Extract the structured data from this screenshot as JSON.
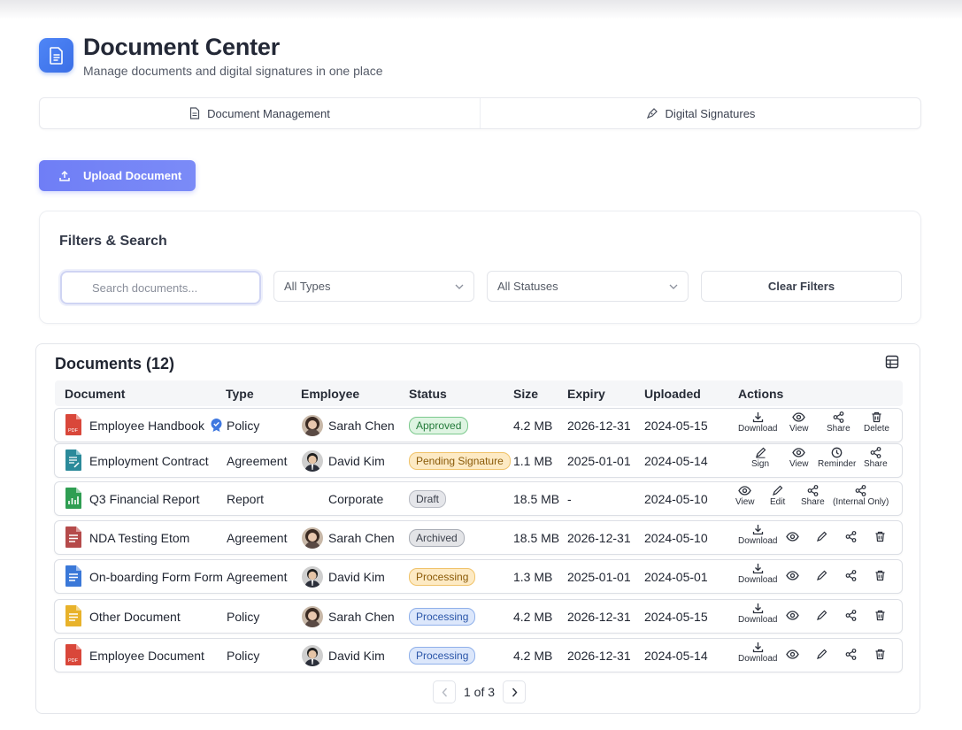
{
  "header": {
    "title": "Document Center",
    "subtitle": "Manage documents and digital signatures in one place",
    "icon": "document-icon"
  },
  "tabs": [
    {
      "label": "Document Management",
      "icon": "file-text-icon"
    },
    {
      "label": "Digital Signatures",
      "icon": "signature-pen-icon"
    }
  ],
  "upload": {
    "label": "Upload Document",
    "icon": "upload-icon"
  },
  "filters": {
    "title": "Filters & Search",
    "search_placeholder": "Search documents...",
    "type_select": "All Types",
    "status_select": "All Statuses",
    "clear_label": "Clear Filters"
  },
  "documents": {
    "title": "Documents (12)",
    "columns": [
      "Document",
      "Type",
      "Employee",
      "Status",
      "Size",
      "Expiry",
      "Uploaded",
      "Actions"
    ],
    "rows": [
      {
        "name": "Employee Handbook",
        "type": "Policy",
        "employee": "Sarah Chen",
        "status": "Approved",
        "size": "4.2 MB",
        "expiry": "2026-12-31",
        "uploaded": "2024-05-15"
      },
      {
        "name": "Employment Contract",
        "type": "Agreement",
        "employee": "David Kim",
        "status": "Pending Signature",
        "size": "1.1 MB",
        "expiry": "2025-01-01",
        "uploaded": "2024-05-14"
      },
      {
        "name": "Q3 Financial Report",
        "type": "Report",
        "employee": "Corporate",
        "status": "Draft",
        "size": "18.5 MB",
        "expiry": "-",
        "uploaded": "2024-05-10"
      },
      {
        "name": "NDA Testing Etom",
        "type": "Agreement",
        "employee": "Sarah Chen",
        "status": "Archived",
        "size": "18.5 MB",
        "expiry": "2026-12-31",
        "uploaded": "2024-05-10"
      },
      {
        "name": "On-boarding Form Form",
        "type": "Agreement",
        "employee": "David Kim",
        "status": "Processing",
        "size": "1.3 MB",
        "expiry": "2025-01-01",
        "uploaded": "2024-05-01"
      },
      {
        "name": "Other Document",
        "type": "Policy",
        "employee": "Sarah Chen",
        "status": "Processing",
        "size": "4.2 MB",
        "expiry": "2026-12-31",
        "uploaded": "2024-05-15"
      },
      {
        "name": "Employee Document",
        "type": "Policy",
        "employee": "David Kim",
        "status": "Processing",
        "size": "4.2 MB",
        "expiry": "2026-12-31",
        "uploaded": "2024-05-14"
      }
    ],
    "action_labels": {
      "download": "Download",
      "view": "View",
      "share": "Share",
      "delete": "Delete",
      "sign": "Sign",
      "reminder": "Reminder",
      "edit": "Edit",
      "internal_share": "(Internal Only)"
    }
  },
  "pagination": {
    "label": "1 of 3"
  },
  "colors": {
    "accent": "#6f7ef6",
    "approved": "#dff5e3",
    "pending": "#fdebc7",
    "draft": "#e6e7ea",
    "processing_blue": "#dde8fb",
    "processing_orange": "#fdebc7"
  }
}
